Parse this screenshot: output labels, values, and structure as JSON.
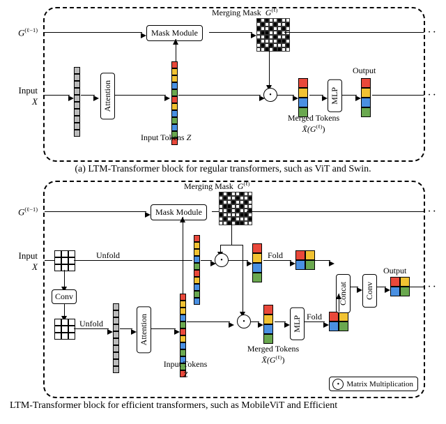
{
  "figA": {
    "top_label_mask": "Merging Mask",
    "top_label_mask_sym": "G",
    "top_label_mask_sup": "(ℓ)",
    "g_prev": "G",
    "g_prev_sup": "(ℓ−1)",
    "mask_module": "Mask Module",
    "input_label": "Input",
    "input_sym": "X",
    "attention": "Attention",
    "input_tokens": "Input Tokens",
    "input_tokens_sym": "Z",
    "merged_tokens": "Merged Tokens",
    "merged_sym1": "X̄(G",
    "merged_sym_sup": "(ℓ)",
    "merged_sym2": ")",
    "mlp": "MLP",
    "output": "Output"
  },
  "captionA": "(a) LTM-Transformer block for regular transformers, such as ViT and Swin.",
  "figB": {
    "top_label_mask": "Merging Mask",
    "top_label_mask_sym": "G",
    "top_label_mask_sup": "(ℓ)",
    "g_prev": "G",
    "g_prev_sup": "(ℓ−1)",
    "mask_module": "Mask Module",
    "input_label": "Input",
    "input_sym": "X",
    "unfold": "Unfold",
    "conv": "Conv",
    "attention": "Attention",
    "input_tokens": "Input Tokens",
    "input_tokens_sym": "Z",
    "merged_tokens": "Merged Tokens",
    "merged_sym1": "X̄(G",
    "merged_sym_sup": "(ℓ)",
    "merged_sym2": ")",
    "mlp": "MLP",
    "fold": "Fold",
    "concat": "Concat",
    "output": "Output",
    "legend": "Matrix Multiplication"
  },
  "captionB": "LTM-Transformer block for efficient transformers, such as MobileViT and Efficient"
}
